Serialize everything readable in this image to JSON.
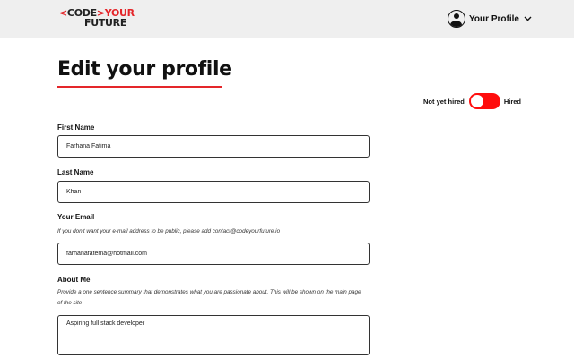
{
  "header": {
    "logo": {
      "part1": "<",
      "part2": "CODE",
      "part3": ">YOUR",
      "part4": "FUTURE"
    },
    "profile_menu_label": "Your Profile"
  },
  "page": {
    "title": "Edit your profile",
    "toggle": {
      "left_label": "Not yet hired",
      "right_label": "Hired",
      "state": "not yet hired",
      "active_color": "#ff0d0d"
    }
  },
  "form": {
    "first_name": {
      "label": "First Name",
      "value": "Farhana Fatima"
    },
    "last_name": {
      "label": "Last Name",
      "value": "Khan"
    },
    "email": {
      "label": "Your Email",
      "hint": "If you don't want your e-mail address to be public, please add contact@codeyourfuture.io",
      "value": "farhanafatema@hotmail.com"
    },
    "about": {
      "label": "About Me",
      "hint": "Provide a one sentence summary that demonstrates what you are passionate about. This will be shown on the main page of the site",
      "value": "Aspiring full stack developer"
    }
  },
  "colors": {
    "brand_red": "#e4262a",
    "header_bg": "#efefef"
  },
  "icons": {
    "profile": "user-circle-icon",
    "chevron": "chevron-down-icon"
  }
}
